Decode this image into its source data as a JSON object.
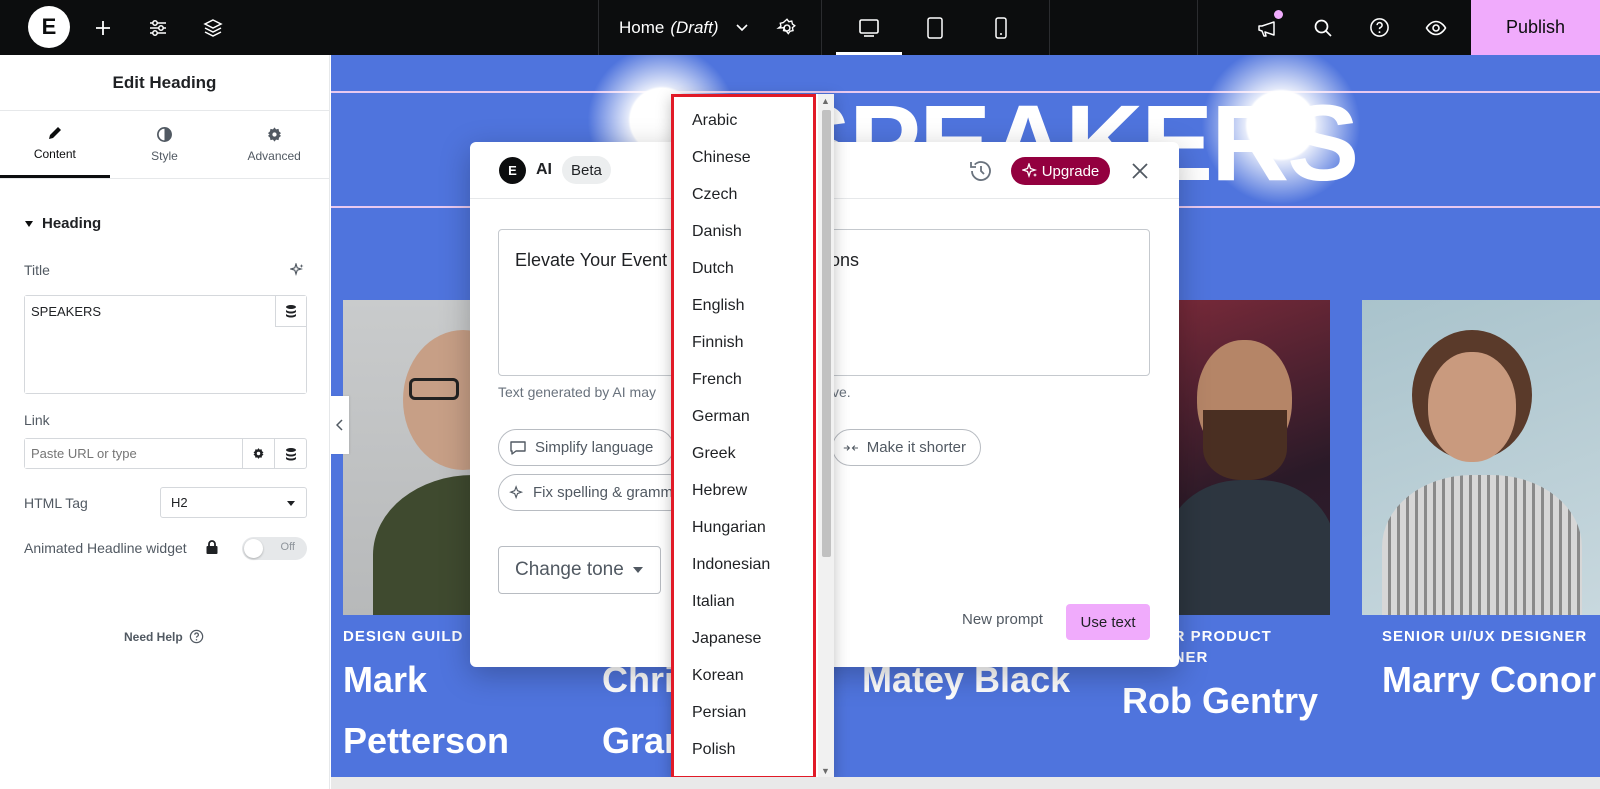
{
  "topbar": {
    "logo": "E",
    "page_title": "Home",
    "page_status": "(Draft)",
    "publish_label": "Publish"
  },
  "panel": {
    "title": "Edit Heading",
    "tabs": [
      {
        "label": "Content"
      },
      {
        "label": "Style"
      },
      {
        "label": "Advanced"
      }
    ],
    "section": "Heading",
    "title_label": "Title",
    "title_value": "SPEAKERS",
    "link_label": "Link",
    "link_placeholder": "Paste URL or type",
    "html_tag_label": "HTML Tag",
    "html_tag_value": "H2",
    "animated_label": "Animated Headline widget",
    "toggle_text": "Off",
    "need_help": "Need Help"
  },
  "canvas": {
    "heading": "SPEAKERS",
    "speakers": [
      {
        "role": "DESIGN GUILD",
        "name_line1": "Mark",
        "name_line2": "Petterson"
      },
      {
        "role": "",
        "name_line1": "Chris",
        "name_line2": "Grant"
      },
      {
        "role": "",
        "name_line1": "Matey Black",
        "name_line2": ""
      },
      {
        "role": "SENIOR PRODUCT",
        "role_line2": "DESIGNER",
        "name_line1": "Rob Gentry",
        "name_line2": ""
      },
      {
        "role": "SENIOR UI/UX DESIGNER",
        "name_line1": "Marry Conor",
        "name_line2": ""
      }
    ]
  },
  "modal": {
    "logo": "E",
    "ai_label": "AI",
    "beta_label": "Beta",
    "upgrade_label": "Upgrade",
    "prompt_left": "Elevate Your Event",
    "prompt_right": "ons",
    "disclaimer_left": "Text generated by AI may",
    "disclaimer_right": "ve.",
    "chips": {
      "simplify": "Simplify language",
      "shorter": "Make it shorter",
      "fix": "Fix spelling & gramm"
    },
    "tone_label": "Change tone",
    "new_prompt": "New prompt",
    "use_text": "Use text"
  },
  "languages": [
    "Arabic",
    "Chinese",
    "Czech",
    "Danish",
    "Dutch",
    "English",
    "Finnish",
    "French",
    "German",
    "Greek",
    "Hebrew",
    "Hungarian",
    "Indonesian",
    "Italian",
    "Japanese",
    "Korean",
    "Persian",
    "Polish"
  ],
  "colors": {
    "canvas_bg": "#4f74dd",
    "accent_pink": "#f0abfc",
    "upgrade_bg": "#93003f",
    "highlight_red": "#e11a27"
  },
  "icons": [
    "plus-icon",
    "sliders-icon",
    "layers-icon",
    "chevron-down-icon",
    "gear-icon",
    "desktop-icon",
    "tablet-icon",
    "mobile-icon",
    "megaphone-icon",
    "search-icon",
    "help-icon",
    "eye-icon",
    "pencil-icon",
    "contrast-icon",
    "sparkle-icon",
    "database-icon",
    "lock-icon",
    "history-icon",
    "close-icon"
  ]
}
